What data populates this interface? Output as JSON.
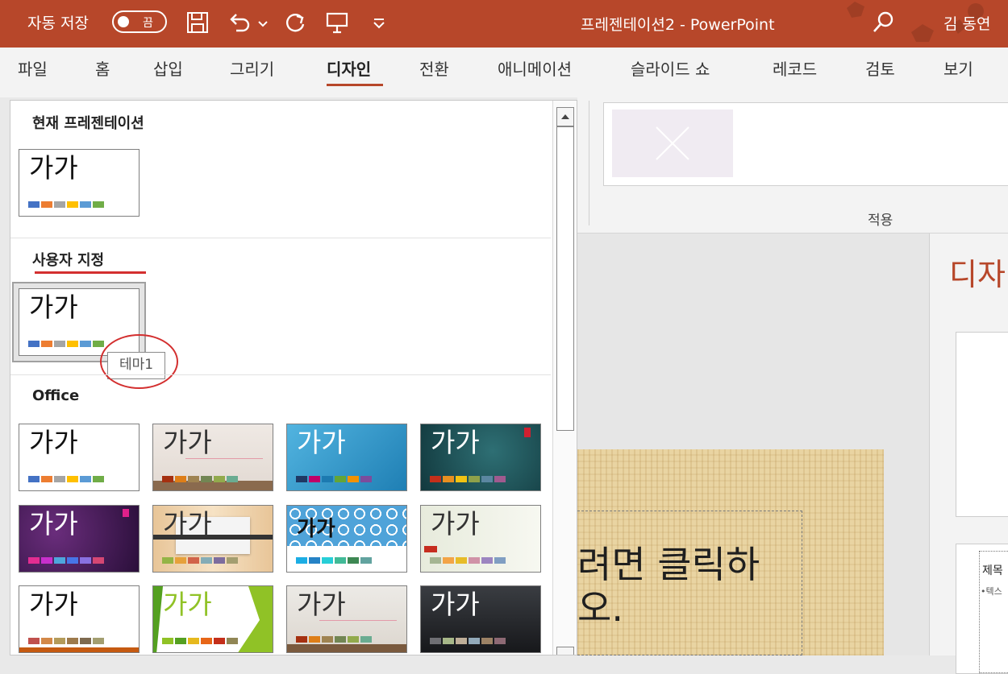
{
  "titlebar": {
    "autosave_label": "자동 저장",
    "autosave_state": "끔",
    "doc_title": "프레젠테이션2  -  PowerPoint",
    "user_name": "김 동연",
    "color": "#b7472a"
  },
  "ribbon": {
    "tabs": [
      "파일",
      "홈",
      "삽입",
      "그리기",
      "디자인",
      "전환",
      "애니메이션",
      "슬라이드 쇼",
      "레코드",
      "검토",
      "보기"
    ],
    "active_tab": "디자인",
    "group_label": "적용"
  },
  "gallery": {
    "current_section": "현재 프레젠테이션",
    "custom_section": "사용자 지정",
    "office_section": "Office",
    "theme_sample_text": "가가",
    "tooltip": "테마1"
  },
  "slide": {
    "text_line1": "려면 클릭하",
    "text_line2": "오."
  },
  "right_pane": {
    "heading": "디자",
    "box_title": "제목",
    "box_sub": "•텍스"
  },
  "icons": [
    "save-icon",
    "undo-icon",
    "redo-icon",
    "presentation-icon",
    "customize-dropdown-icon",
    "search-icon"
  ]
}
